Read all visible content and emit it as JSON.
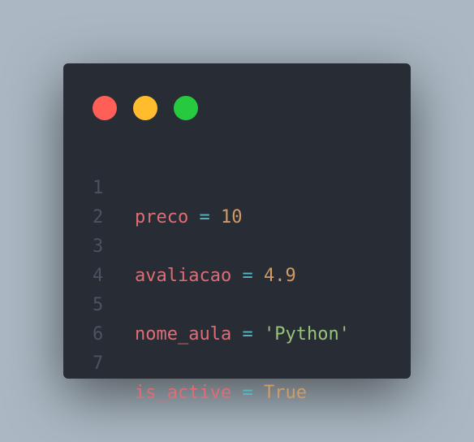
{
  "window": {
    "controls": [
      "close",
      "minimize",
      "maximize"
    ]
  },
  "colors": {
    "background": "#abb8c3",
    "editor_bg": "#282c34",
    "close": "#ff5f56",
    "minimize": "#ffbd2e",
    "maximize": "#27c93f",
    "variable": "#e06c75",
    "operator": "#56b6c2",
    "number": "#d19a66",
    "string": "#98c379",
    "line_number": "#4b5263"
  },
  "code": {
    "lines": [
      {
        "num": "1",
        "var": "preco",
        "op": "=",
        "value": "10",
        "value_type": "number"
      },
      {
        "num": "2"
      },
      {
        "num": "3",
        "var": "avaliacao",
        "op": "=",
        "value": "4.9",
        "value_type": "number"
      },
      {
        "num": "4"
      },
      {
        "num": "5",
        "var": "nome_aula",
        "op": "=",
        "value": "'Python'",
        "value_type": "string"
      },
      {
        "num": "6"
      },
      {
        "num": "7",
        "var": "is_active",
        "op": "=",
        "value": "True",
        "value_type": "constant"
      }
    ]
  }
}
